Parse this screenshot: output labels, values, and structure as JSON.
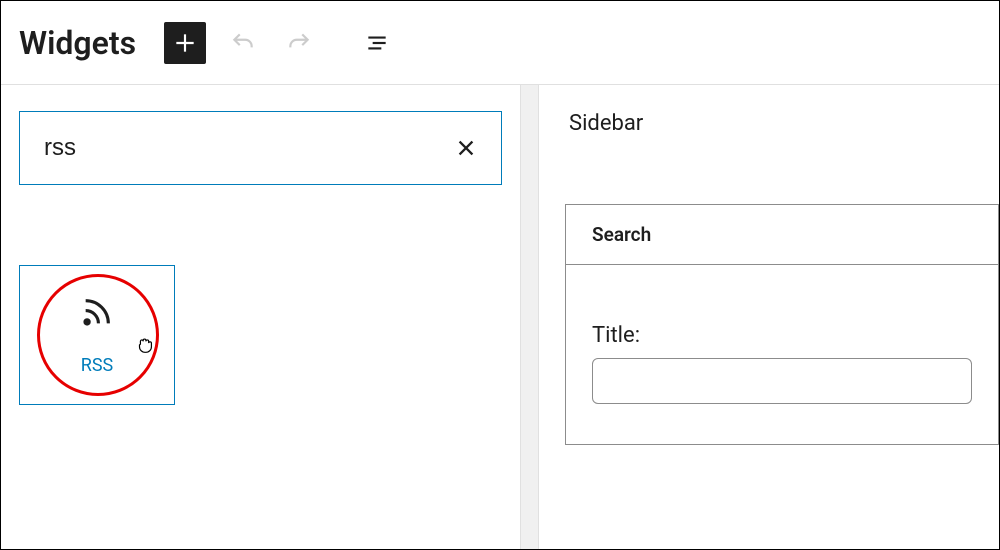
{
  "header": {
    "title": "Widgets"
  },
  "inserter": {
    "search_value": "rss",
    "block": {
      "label": "RSS"
    }
  },
  "sidebar": {
    "title": "Sidebar",
    "widget": {
      "header": "Search",
      "title_label": "Title:",
      "title_value": ""
    }
  }
}
